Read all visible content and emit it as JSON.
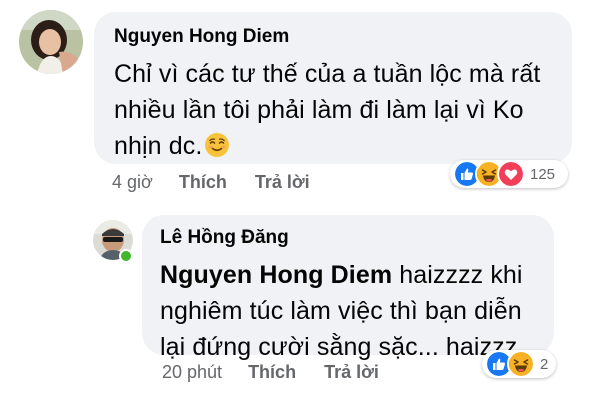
{
  "comments": [
    {
      "author": "Nguyen Hong Diem",
      "lines": [
        "Chỉ vì các tư thế của a tuần lộc mà rất",
        "nhiều lần tôi phải làm đi làm lại vì Ko",
        "nhịn dc."
      ],
      "emoji": "relieved-face-icon",
      "time": "4 giờ",
      "like_label": "Thích",
      "reply_label": "Trả lời",
      "reactions": [
        "like",
        "haha",
        "love"
      ],
      "reaction_count": "125"
    },
    {
      "author": "Lê Hồng Đăng",
      "mention": "Nguyen Hong Diem",
      "lines": [
        "haizzzz khi",
        "nghiêm túc làm việc thì bạn diễn",
        "lại đứng cười sằng sặc... haizzz"
      ],
      "time": "20 phút",
      "like_label": "Thích",
      "reply_label": "Trả lời",
      "reactions": [
        "like",
        "haha"
      ],
      "reaction_count": "2"
    }
  ],
  "colors": {
    "bubble": "#f0f2f5",
    "text": "#050505",
    "meta": "#65676b",
    "like": "#1877f2",
    "love": "#f33e58",
    "haha": "#f7b125",
    "online": "#42b72a"
  }
}
